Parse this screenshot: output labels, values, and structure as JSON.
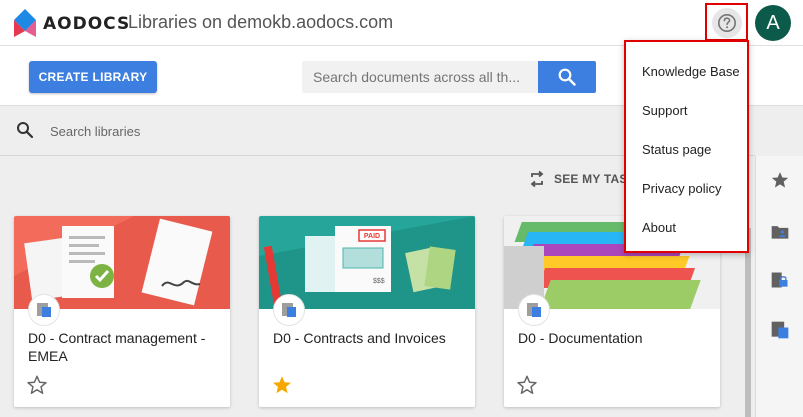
{
  "header": {
    "brand": "AODOCS",
    "page_title": "Libraries on demokb.aodocs.com",
    "avatar_letter": "A"
  },
  "toolbar": {
    "create_label": "CREATE LIBRARY",
    "search_placeholder": "Search documents across all th..."
  },
  "library_search": {
    "placeholder": "Search libraries"
  },
  "tasks": {
    "label": "SEE MY TASKS"
  },
  "help_menu": {
    "items": [
      {
        "label": "Knowledge Base"
      },
      {
        "label": "Support"
      },
      {
        "label": "Status page"
      },
      {
        "label": "Privacy policy"
      },
      {
        "label": "About"
      }
    ]
  },
  "libraries": [
    {
      "title": "D0 - Contract management - EMEA",
      "starred": false
    },
    {
      "title": "D0 - Contracts and Invoices",
      "starred": true
    },
    {
      "title": "D0 - Documentation",
      "starred": false
    }
  ],
  "banner_texts": {
    "paid_stamp": "PAID",
    "invoice_amount": "$$$"
  },
  "rail_icons": [
    "star-icon",
    "shared-folder-icon",
    "locked-folder-icon",
    "library-icon"
  ],
  "colors": {
    "accent": "#3d7fe0",
    "avatar": "#0b5a4a",
    "highlight_border": "#e00000",
    "star_filled": "#f6a800",
    "banner_contracts": "#f26b5b",
    "banner_invoices": "#26a69a"
  }
}
